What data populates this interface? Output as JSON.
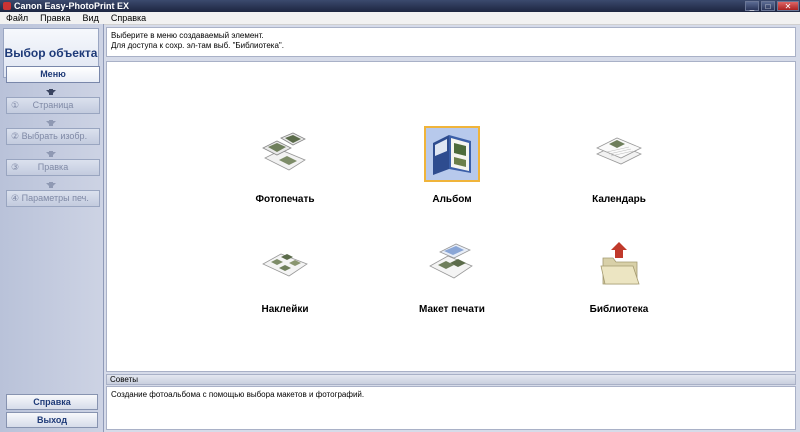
{
  "window": {
    "title": "Canon Easy-PhotoPrint EX"
  },
  "menubar": {
    "items": [
      "Файл",
      "Правка",
      "Вид",
      "Справка"
    ]
  },
  "sidebar": {
    "header": "Выбор объекта",
    "steps": [
      {
        "num": "",
        "label": "Меню"
      },
      {
        "num": "①",
        "label": "Страница"
      },
      {
        "num": "②",
        "label": "Выбрать изобр."
      },
      {
        "num": "③",
        "label": "Правка"
      },
      {
        "num": "④",
        "label": "Параметры печ."
      }
    ],
    "help_label": "Справка",
    "exit_label": "Выход"
  },
  "instruction": {
    "line1": "Выберите в меню создаваемый элемент.",
    "line2": "Для доступа к сохр. эл-там выб. \"Библиотека\"."
  },
  "menu_items": [
    {
      "label": "Фотопечать",
      "icon": "photo-print-icon"
    },
    {
      "label": "Альбом",
      "icon": "album-icon",
      "selected": true
    },
    {
      "label": "Календарь",
      "icon": "calendar-icon"
    },
    {
      "label": "Наклейки",
      "icon": "stickers-icon"
    },
    {
      "label": "Макет печати",
      "icon": "layout-print-icon"
    },
    {
      "label": "Библиотека",
      "icon": "library-folder-icon"
    }
  ],
  "tips": {
    "header": "Советы",
    "text": "Создание фотоальбома с помощью выбора макетов и фотографий."
  }
}
